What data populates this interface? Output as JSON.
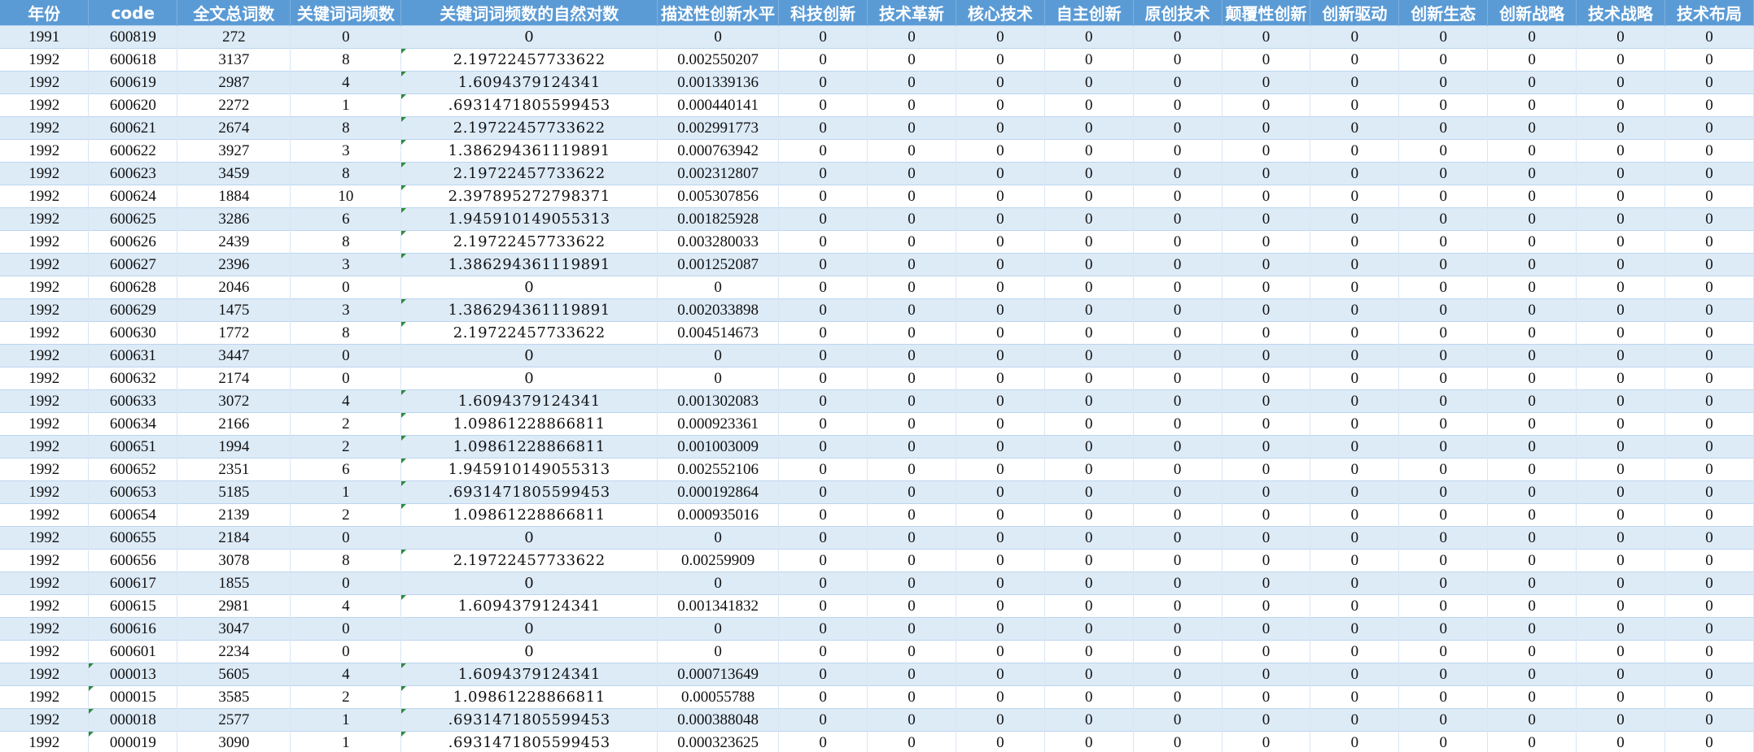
{
  "columns": [
    "年份",
    "code",
    "全文总词数",
    "关键词词频数",
    "关键词词频数的自然对数",
    "描述性创新水平",
    "科技创新",
    "技术革新",
    "核心技术",
    "自主创新",
    "原创技术",
    "颠覆性创新",
    "创新驱动",
    "创新生态",
    "创新战略",
    "技术战略",
    "技术布局"
  ],
  "rows": [
    {
      "year": "1991",
      "code": "600819",
      "total": "272",
      "freq": "0",
      "ln": "0",
      "desc": "0",
      "vals": [
        "0",
        "0",
        "0",
        "0",
        "0",
        "0",
        "0",
        "0",
        "0",
        "0",
        "0"
      ]
    },
    {
      "year": "1992",
      "code": "600618",
      "total": "3137",
      "freq": "8",
      "ln": "2.19722457733622",
      "desc": "0.002550207",
      "vals": [
        "0",
        "0",
        "0",
        "0",
        "0",
        "0",
        "0",
        "0",
        "0",
        "0",
        "0"
      ]
    },
    {
      "year": "1992",
      "code": "600619",
      "total": "2987",
      "freq": "4",
      "ln": "1.6094379124341",
      "desc": "0.001339136",
      "vals": [
        "0",
        "0",
        "0",
        "0",
        "0",
        "0",
        "0",
        "0",
        "0",
        "0",
        "0"
      ]
    },
    {
      "year": "1992",
      "code": "600620",
      "total": "2272",
      "freq": "1",
      "ln": ".6931471805599453",
      "desc": "0.000440141",
      "vals": [
        "0",
        "0",
        "0",
        "0",
        "0",
        "0",
        "0",
        "0",
        "0",
        "0",
        "0"
      ]
    },
    {
      "year": "1992",
      "code": "600621",
      "total": "2674",
      "freq": "8",
      "ln": "2.19722457733622",
      "desc": "0.002991773",
      "vals": [
        "0",
        "0",
        "0",
        "0",
        "0",
        "0",
        "0",
        "0",
        "0",
        "0",
        "0"
      ]
    },
    {
      "year": "1992",
      "code": "600622",
      "total": "3927",
      "freq": "3",
      "ln": "1.386294361119891",
      "desc": "0.000763942",
      "vals": [
        "0",
        "0",
        "0",
        "0",
        "0",
        "0",
        "0",
        "0",
        "0",
        "0",
        "0"
      ]
    },
    {
      "year": "1992",
      "code": "600623",
      "total": "3459",
      "freq": "8",
      "ln": "2.19722457733622",
      "desc": "0.002312807",
      "vals": [
        "0",
        "0",
        "0",
        "0",
        "0",
        "0",
        "0",
        "0",
        "0",
        "0",
        "0"
      ]
    },
    {
      "year": "1992",
      "code": "600624",
      "total": "1884",
      "freq": "10",
      "ln": "2.397895272798371",
      "desc": "0.005307856",
      "vals": [
        "0",
        "0",
        "0",
        "0",
        "0",
        "0",
        "0",
        "0",
        "0",
        "0",
        "0"
      ]
    },
    {
      "year": "1992",
      "code": "600625",
      "total": "3286",
      "freq": "6",
      "ln": "1.945910149055313",
      "desc": "0.001825928",
      "vals": [
        "0",
        "0",
        "0",
        "0",
        "0",
        "0",
        "0",
        "0",
        "0",
        "0",
        "0"
      ]
    },
    {
      "year": "1992",
      "code": "600626",
      "total": "2439",
      "freq": "8",
      "ln": "2.19722457733622",
      "desc": "0.003280033",
      "vals": [
        "0",
        "0",
        "0",
        "0",
        "0",
        "0",
        "0",
        "0",
        "0",
        "0",
        "0"
      ]
    },
    {
      "year": "1992",
      "code": "600627",
      "total": "2396",
      "freq": "3",
      "ln": "1.386294361119891",
      "desc": "0.001252087",
      "vals": [
        "0",
        "0",
        "0",
        "0",
        "0",
        "0",
        "0",
        "0",
        "0",
        "0",
        "0"
      ]
    },
    {
      "year": "1992",
      "code": "600628",
      "total": "2046",
      "freq": "0",
      "ln": "0",
      "desc": "0",
      "vals": [
        "0",
        "0",
        "0",
        "0",
        "0",
        "0",
        "0",
        "0",
        "0",
        "0",
        "0"
      ]
    },
    {
      "year": "1992",
      "code": "600629",
      "total": "1475",
      "freq": "3",
      "ln": "1.386294361119891",
      "desc": "0.002033898",
      "vals": [
        "0",
        "0",
        "0",
        "0",
        "0",
        "0",
        "0",
        "0",
        "0",
        "0",
        "0"
      ]
    },
    {
      "year": "1992",
      "code": "600630",
      "total": "1772",
      "freq": "8",
      "ln": "2.19722457733622",
      "desc": "0.004514673",
      "vals": [
        "0",
        "0",
        "0",
        "0",
        "0",
        "0",
        "0",
        "0",
        "0",
        "0",
        "0"
      ]
    },
    {
      "year": "1992",
      "code": "600631",
      "total": "3447",
      "freq": "0",
      "ln": "0",
      "desc": "0",
      "vals": [
        "0",
        "0",
        "0",
        "0",
        "0",
        "0",
        "0",
        "0",
        "0",
        "0",
        "0"
      ]
    },
    {
      "year": "1992",
      "code": "600632",
      "total": "2174",
      "freq": "0",
      "ln": "0",
      "desc": "0",
      "vals": [
        "0",
        "0",
        "0",
        "0",
        "0",
        "0",
        "0",
        "0",
        "0",
        "0",
        "0"
      ]
    },
    {
      "year": "1992",
      "code": "600633",
      "total": "3072",
      "freq": "4",
      "ln": "1.6094379124341",
      "desc": "0.001302083",
      "vals": [
        "0",
        "0",
        "0",
        "0",
        "0",
        "0",
        "0",
        "0",
        "0",
        "0",
        "0"
      ]
    },
    {
      "year": "1992",
      "code": "600634",
      "total": "2166",
      "freq": "2",
      "ln": "1.09861228866811",
      "desc": "0.000923361",
      "vals": [
        "0",
        "0",
        "0",
        "0",
        "0",
        "0",
        "0",
        "0",
        "0",
        "0",
        "0"
      ]
    },
    {
      "year": "1992",
      "code": "600651",
      "total": "1994",
      "freq": "2",
      "ln": "1.09861228866811",
      "desc": "0.001003009",
      "vals": [
        "0",
        "0",
        "0",
        "0",
        "0",
        "0",
        "0",
        "0",
        "0",
        "0",
        "0"
      ]
    },
    {
      "year": "1992",
      "code": "600652",
      "total": "2351",
      "freq": "6",
      "ln": "1.945910149055313",
      "desc": "0.002552106",
      "vals": [
        "0",
        "0",
        "0",
        "0",
        "0",
        "0",
        "0",
        "0",
        "0",
        "0",
        "0"
      ]
    },
    {
      "year": "1992",
      "code": "600653",
      "total": "5185",
      "freq": "1",
      "ln": ".6931471805599453",
      "desc": "0.000192864",
      "vals": [
        "0",
        "0",
        "0",
        "0",
        "0",
        "0",
        "0",
        "0",
        "0",
        "0",
        "0"
      ]
    },
    {
      "year": "1992",
      "code": "600654",
      "total": "2139",
      "freq": "2",
      "ln": "1.09861228866811",
      "desc": "0.000935016",
      "vals": [
        "0",
        "0",
        "0",
        "0",
        "0",
        "0",
        "0",
        "0",
        "0",
        "0",
        "0"
      ]
    },
    {
      "year": "1992",
      "code": "600655",
      "total": "2184",
      "freq": "0",
      "ln": "0",
      "desc": "0",
      "vals": [
        "0",
        "0",
        "0",
        "0",
        "0",
        "0",
        "0",
        "0",
        "0",
        "0",
        "0"
      ]
    },
    {
      "year": "1992",
      "code": "600656",
      "total": "3078",
      "freq": "8",
      "ln": "2.19722457733622",
      "desc": "0.00259909",
      "vals": [
        "0",
        "0",
        "0",
        "0",
        "0",
        "0",
        "0",
        "0",
        "0",
        "0",
        "0"
      ]
    },
    {
      "year": "1992",
      "code": "600617",
      "total": "1855",
      "freq": "0",
      "ln": "0",
      "desc": "0",
      "vals": [
        "0",
        "0",
        "0",
        "0",
        "0",
        "0",
        "0",
        "0",
        "0",
        "0",
        "0"
      ]
    },
    {
      "year": "1992",
      "code": "600615",
      "total": "2981",
      "freq": "4",
      "ln": "1.6094379124341",
      "desc": "0.001341832",
      "vals": [
        "0",
        "0",
        "0",
        "0",
        "0",
        "0",
        "0",
        "0",
        "0",
        "0",
        "0"
      ]
    },
    {
      "year": "1992",
      "code": "600616",
      "total": "3047",
      "freq": "0",
      "ln": "0",
      "desc": "0",
      "vals": [
        "0",
        "0",
        "0",
        "0",
        "0",
        "0",
        "0",
        "0",
        "0",
        "0",
        "0"
      ]
    },
    {
      "year": "1992",
      "code": "600601",
      "total": "2234",
      "freq": "0",
      "ln": "0",
      "desc": "0",
      "vals": [
        "0",
        "0",
        "0",
        "0",
        "0",
        "0",
        "0",
        "0",
        "0",
        "0",
        "0"
      ]
    },
    {
      "year": "1992",
      "code": "000013",
      "total": "5605",
      "freq": "4",
      "ln": "1.6094379124341",
      "desc": "0.000713649",
      "vals": [
        "0",
        "0",
        "0",
        "0",
        "0",
        "0",
        "0",
        "0",
        "0",
        "0",
        "0"
      ]
    },
    {
      "year": "1992",
      "code": "000015",
      "total": "3585",
      "freq": "2",
      "ln": "1.09861228866811",
      "desc": "0.00055788",
      "vals": [
        "0",
        "0",
        "0",
        "0",
        "0",
        "0",
        "0",
        "0",
        "0",
        "0",
        "0"
      ]
    },
    {
      "year": "1992",
      "code": "000018",
      "total": "2577",
      "freq": "1",
      "ln": ".6931471805599453",
      "desc": "0.000388048",
      "vals": [
        "0",
        "0",
        "0",
        "0",
        "0",
        "0",
        "0",
        "0",
        "0",
        "0",
        "0"
      ]
    },
    {
      "year": "1992",
      "code": "000019",
      "total": "3090",
      "freq": "1",
      "ln": ".6931471805599453",
      "desc": "0.000323625",
      "vals": [
        "0",
        "0",
        "0",
        "0",
        "0",
        "0",
        "0",
        "0",
        "0",
        "0",
        "0"
      ]
    }
  ],
  "colors": {
    "header_bg": "#5b9bd5",
    "band_bg": "#ddebf7",
    "text_marker": "#2e8b3a"
  }
}
